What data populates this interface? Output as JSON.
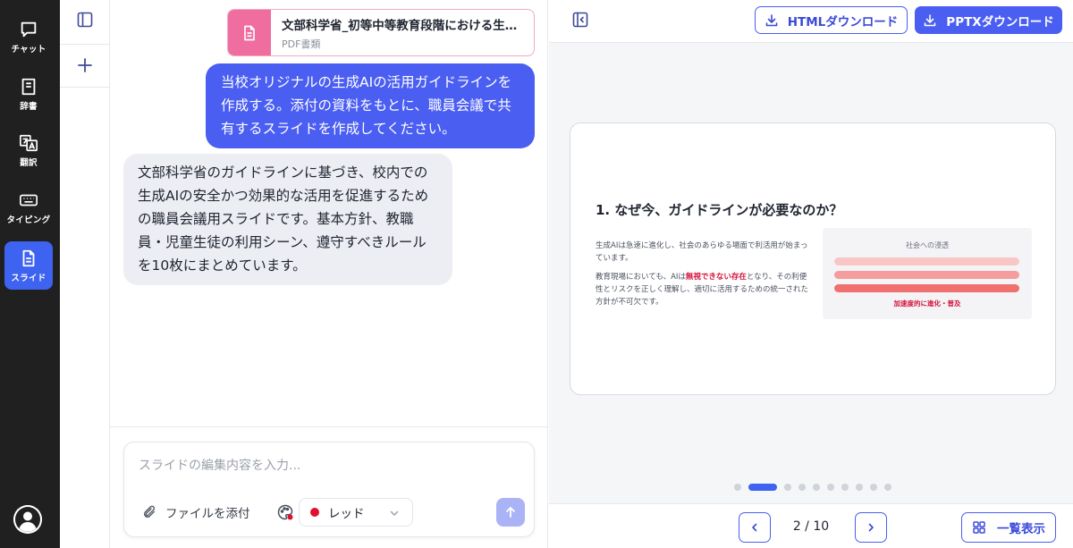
{
  "rail": {
    "items": [
      {
        "label": "チャット",
        "icon": "chat-bubble-icon"
      },
      {
        "label": "辞書",
        "icon": "book-icon"
      },
      {
        "label": "翻訳",
        "icon": "translate-icon"
      },
      {
        "label": "タイピング",
        "icon": "keyboard-icon"
      },
      {
        "label": "スライド",
        "icon": "document-icon",
        "active": true
      }
    ],
    "avatar_icon": "user-avatar-icon"
  },
  "chat": {
    "attachment": {
      "name": "文部科学省_初等中等教育段階における生…",
      "type": "PDF書類",
      "icon": "pdf-file-icon",
      "color": "#f06e9f"
    },
    "user_message": "当校オリジナルの生成AIの活用ガイドラインを作成する。添付の資料をもとに、職員会議で共有するスライドを作成してください。",
    "assistant_message": "文部科学省のガイドラインに基づき、校内での生成AIの安全かつ効果的な活用を促進するための職員会議用スライドです。基本方針、教職員・児童生徒の利用シーン、遵守すべきルールを10枚にまとめています。",
    "composer": {
      "placeholder": "スライドの編集内容を入力...",
      "attach_label": "ファイルを添付",
      "color_option": "レッド",
      "color_hex": "#e0102e"
    }
  },
  "preview": {
    "html_download_label": "HTMLダウンロード",
    "pptx_download_label": "PPTXダウンロード",
    "accent": "#4a5ef2",
    "slide": {
      "title": "1. なぜ今、ガイドラインが必要なのか？",
      "para1": "生成AIは急速に進化し、社会のあらゆる場面で利活用が始まっています。",
      "para2_before": "教育現場においても、AIは",
      "para2_highlight": "無視できない存在",
      "para2_after": "となり、その利便性とリスクを正しく理解し、適切に活用するための統一された方針が不可欠です。",
      "box_title": "社会への浸透",
      "box_caption": "加速度的に進化・普及",
      "bars": [
        {
          "color": "#f9c6c6"
        },
        {
          "color": "#f59c9c"
        },
        {
          "color": "#f0706f"
        }
      ]
    },
    "dots_total": 10,
    "current_index": 2,
    "pager": "2 / 10",
    "list_label": "一覧表示"
  }
}
